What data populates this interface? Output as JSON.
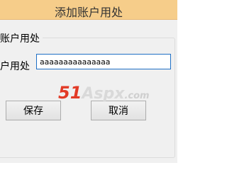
{
  "window": {
    "title": "添加账户用处"
  },
  "group": {
    "label": "账户用处"
  },
  "form": {
    "field_label": "户用处",
    "field_value": "aaaaaaaaaaaaaaa"
  },
  "buttons": {
    "save_label": "保存",
    "cancel_label": "取消"
  },
  "watermark": {
    "number": "51",
    "brand": "Aspx",
    "tld": ".com"
  },
  "colors": {
    "title_bar": "#f6cd8a",
    "input_border": "#1f6fc5",
    "watermark_accent": "#e23a26",
    "background": "#f0f0f0"
  }
}
